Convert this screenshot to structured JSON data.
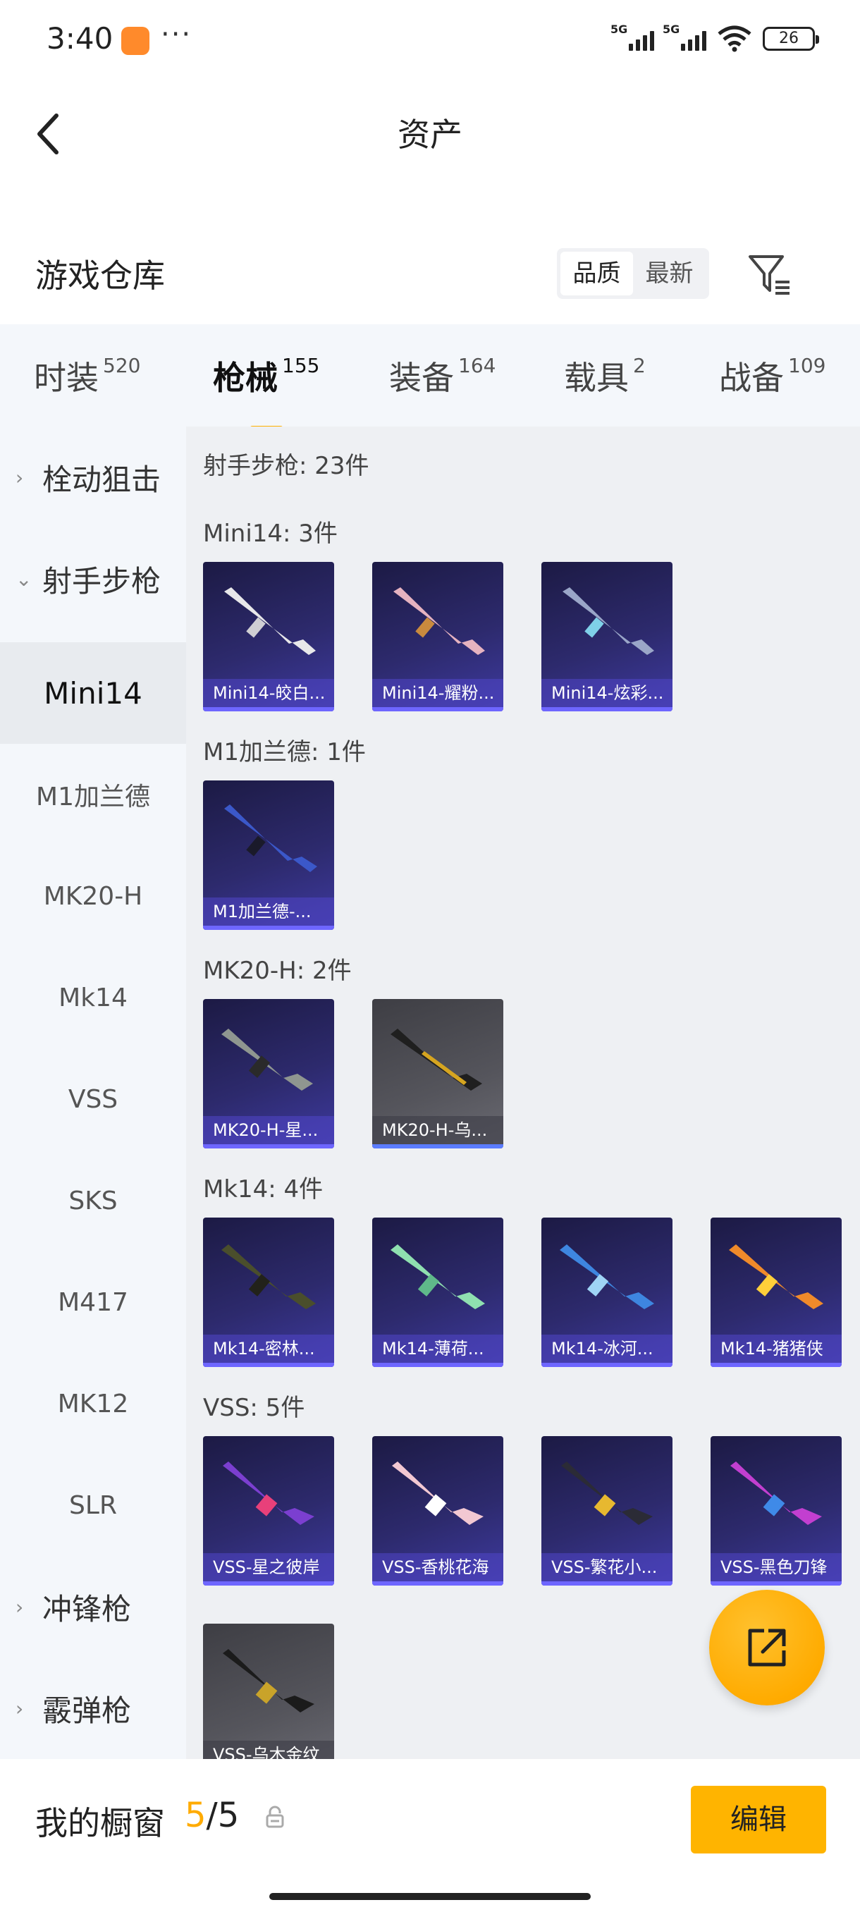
{
  "status": {
    "time": "3:40",
    "dots": "···",
    "sig1": "5G",
    "sig2": "5G",
    "battery": "26"
  },
  "header": {
    "title": "资产"
  },
  "section": {
    "title": "游戏仓库",
    "sort": [
      "品质",
      "最新"
    ]
  },
  "tabs": [
    {
      "label": "时装",
      "count": "520"
    },
    {
      "label": "枪械",
      "count": "155"
    },
    {
      "label": "装备",
      "count": "164"
    },
    {
      "label": "载具",
      "count": "2"
    },
    {
      "label": "战备",
      "count": "109"
    }
  ],
  "sidebar": {
    "items": [
      "栓动狙击",
      "射手步枪",
      "Mini14",
      "M1加兰德",
      "MK20-H",
      "Mk14",
      "VSS",
      "SKS",
      "M417",
      "MK12",
      "SLR",
      "冲锋枪",
      "霰弹枪"
    ],
    "chev_right": "›",
    "chev_down": "⌄"
  },
  "content": {
    "summary": "射手步枪: 23件",
    "groups": [
      {
        "title": "Mini14: 3件",
        "cards": [
          "Mini14-皎白...",
          "Mini14-耀粉...",
          "Mini14-炫彩..."
        ]
      },
      {
        "title": "M1加兰德: 1件",
        "cards": [
          "M1加兰德-..."
        ]
      },
      {
        "title": "MK20-H: 2件",
        "cards": [
          "MK20-H-星...",
          "MK20-H-乌..."
        ]
      },
      {
        "title": "Mk14: 4件",
        "cards": [
          "Mk14-密林...",
          "Mk14-薄荷...",
          "Mk14-冰河...",
          "Mk14-猪猪侠"
        ]
      },
      {
        "title": "VSS: 5件",
        "cards": [
          "VSS-星之彼岸",
          "VSS-香桃花海",
          "VSS-繁花小...",
          "VSS-黑色刀锋",
          "VSS-乌木金纹"
        ]
      }
    ]
  },
  "bottom": {
    "label": "我的橱窗",
    "current": "5",
    "total": "/5",
    "edit": "编辑"
  },
  "icons": [
    "back-arrow-icon",
    "filter-icon",
    "lock-icon",
    "share-external-icon",
    "chevron-right-icon",
    "chevron-down-icon",
    "wifi-icon",
    "battery-icon"
  ],
  "colors": {
    "accent": "#ffb000",
    "card_bg": "#2d2a6d",
    "card_bar": "#6e66ff",
    "grey_card": "#55555c"
  }
}
